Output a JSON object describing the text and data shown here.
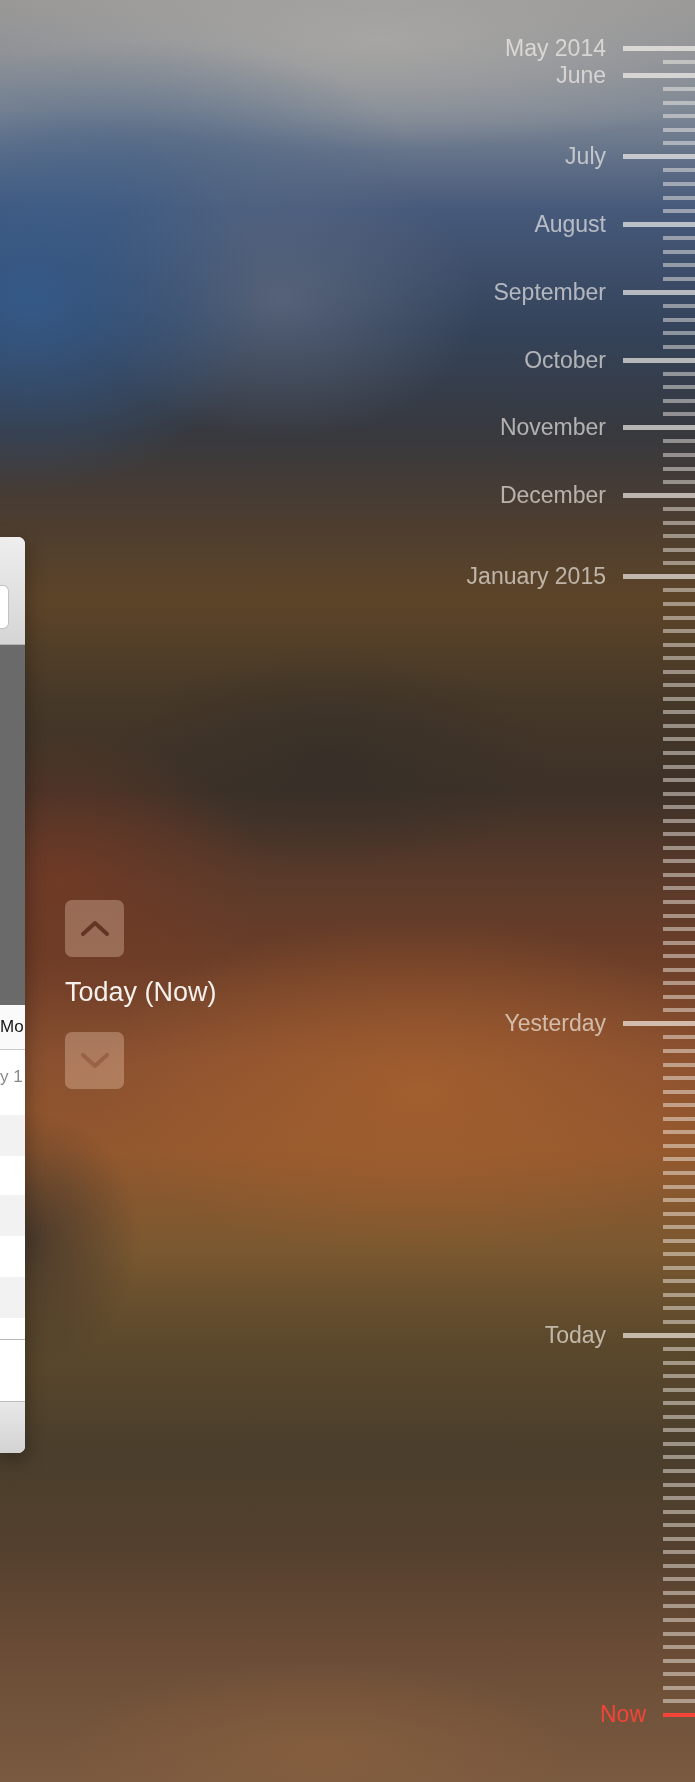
{
  "background_window": {
    "table": {
      "columns": [
        "Mo"
      ],
      "rows": [
        [
          "y 1"
        ]
      ]
    }
  },
  "navigation": {
    "up_button": {
      "disabled": false
    },
    "current_label": "Today (Now)",
    "down_button": {
      "disabled": true
    }
  },
  "timeline": {
    "entries": [
      {
        "label": "May 2014",
        "kind": "date",
        "selected": false
      },
      {
        "label": "June",
        "kind": "date",
        "selected": false
      },
      {
        "label": "July",
        "kind": "date",
        "selected": false
      },
      {
        "label": "August",
        "kind": "date",
        "selected": false
      },
      {
        "label": "September",
        "kind": "date",
        "selected": false
      },
      {
        "label": "October",
        "kind": "date",
        "selected": false
      },
      {
        "label": "November",
        "kind": "date",
        "selected": false
      },
      {
        "label": "December",
        "kind": "date",
        "selected": false
      },
      {
        "label": "January 2015",
        "kind": "date",
        "selected": false
      },
      {
        "label": "Yesterday",
        "kind": "date",
        "selected": false
      },
      {
        "label": "Today",
        "kind": "date",
        "selected": false
      },
      {
        "label": "Now",
        "kind": "now",
        "selected": true
      }
    ]
  }
}
